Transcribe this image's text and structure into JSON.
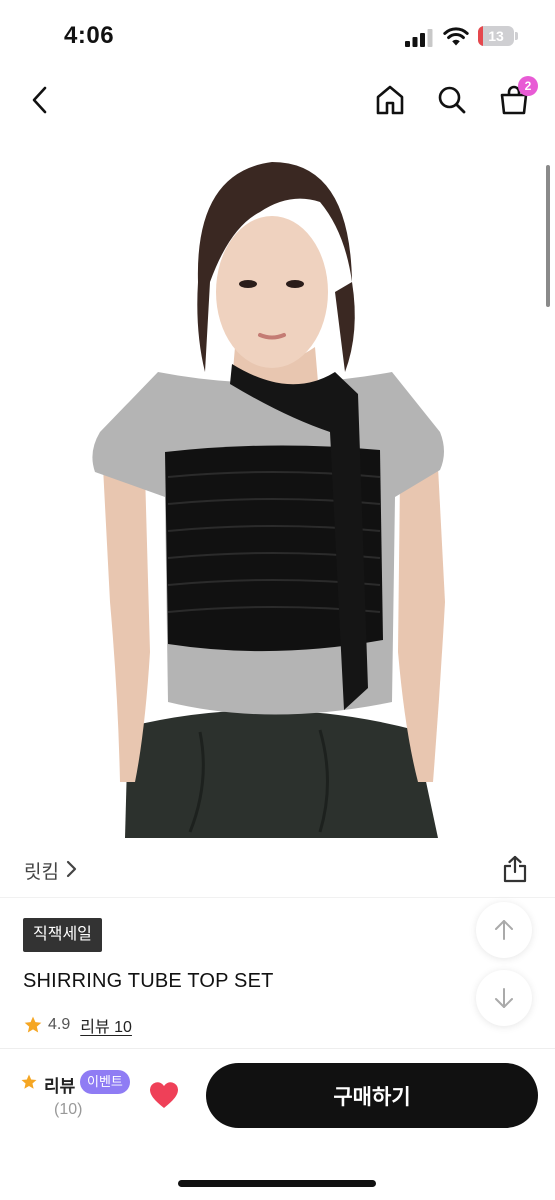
{
  "status_bar": {
    "time": "4:06",
    "battery_level": "13",
    "battery_fraction": 0.13,
    "battery_color": "#e5484d"
  },
  "nav": {
    "back_icon": "chevron-left-icon",
    "home_icon": "home-icon",
    "search_icon": "search-icon",
    "cart_icon": "shopping-bag-icon",
    "cart_count": "2",
    "cart_badge_color": "#e85bd5"
  },
  "product": {
    "brand": "릿킴",
    "sale_badge": "직잭세일",
    "title": "SHIRRING TUBE TOP SET",
    "rating": "4.9",
    "review_link": "리뷰 10",
    "image_alt_icon": "product-photo"
  },
  "float_buttons": {
    "up_icon": "arrow-up-icon",
    "down_icon": "arrow-down-icon"
  },
  "bottom_bar": {
    "review_label": "리뷰",
    "event_badge": "이벤트",
    "review_count": "(10)",
    "heart_icon": "heart-icon",
    "heart_color": "#ef4058",
    "buy_label": "구매하기",
    "event_color": "#8f7cf4"
  }
}
